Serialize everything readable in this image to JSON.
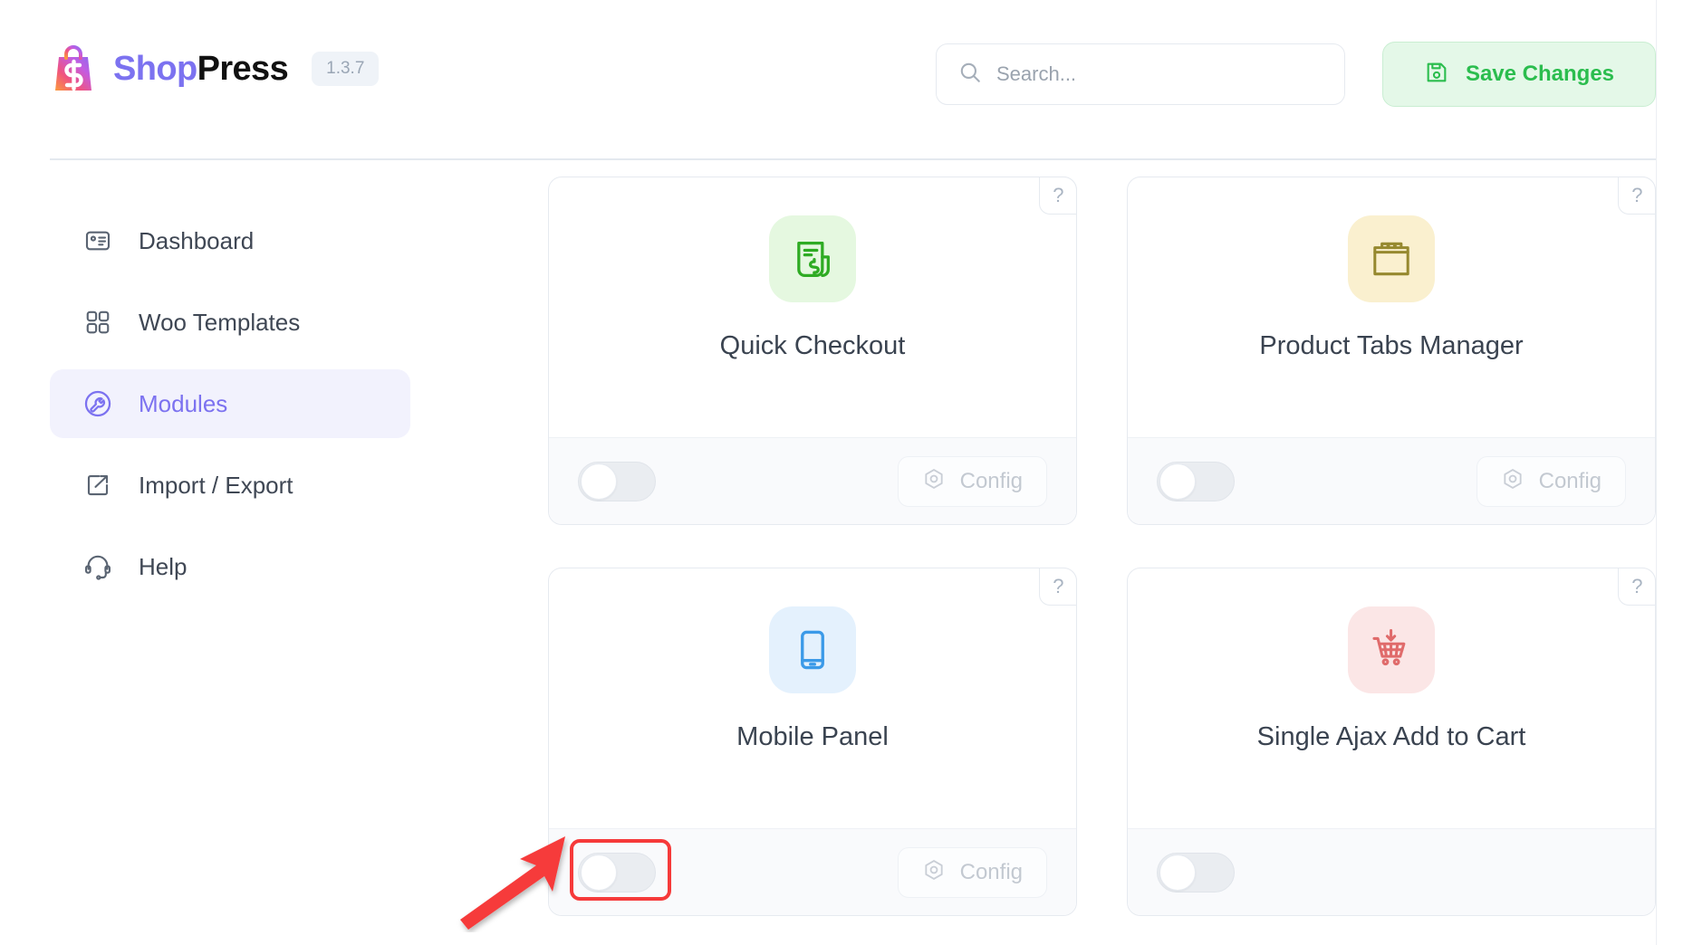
{
  "header": {
    "brand_shop": "Shop",
    "brand_press": "Press",
    "version": "1.3.7",
    "logo_icon": "shopping-bag-logo-icon",
    "search": {
      "placeholder": "Search...",
      "value": "",
      "icon": "search-icon"
    },
    "save_button": {
      "label": "Save Changes",
      "icon": "save-floppy-icon",
      "bg_color": "#e4f8e8",
      "text_color": "#2bbd4e"
    }
  },
  "sidebar": {
    "items": [
      {
        "label": "Dashboard",
        "icon": "dashboard-card-icon",
        "active": false
      },
      {
        "label": "Woo Templates",
        "icon": "grid-squares-icon",
        "active": false
      },
      {
        "label": "Modules",
        "icon": "wrench-circle-icon",
        "active": true
      },
      {
        "label": "Import / Export",
        "icon": "export-arrow-icon",
        "active": false
      },
      {
        "label": "Help",
        "icon": "headset-icon",
        "active": false
      }
    ],
    "active_color": "#7c72f0",
    "active_bg": "#f2f2fd"
  },
  "main": {
    "help_badge": "?",
    "config_label": "Config",
    "config_icon": "hexagon-settings-icon",
    "modules": [
      {
        "title": "Quick Checkout",
        "icon": "receipt-dollar-icon",
        "icon_bg": "#e5f8e0",
        "icon_color": "#2eab23",
        "enabled": false,
        "has_config": true,
        "highlighted": false
      },
      {
        "title": "Product Tabs Manager",
        "icon": "folder-tabs-icon",
        "icon_bg": "#faf0cf",
        "icon_color": "#96892f",
        "enabled": false,
        "has_config": true,
        "highlighted": false
      },
      {
        "title": "Mobile Panel",
        "icon": "mobile-phone-icon",
        "icon_bg": "#e4f1fd",
        "icon_color": "#3b9ae8",
        "enabled": false,
        "has_config": true,
        "highlighted": true
      },
      {
        "title": "Single Ajax Add to Cart",
        "icon": "cart-down-arrow-icon",
        "icon_bg": "#fbe6e6",
        "icon_color": "#e06b6b",
        "enabled": false,
        "has_config": false,
        "highlighted": false
      }
    ]
  },
  "annotation": {
    "color": "#f63a3a",
    "target": "mobile-panel-toggle"
  }
}
